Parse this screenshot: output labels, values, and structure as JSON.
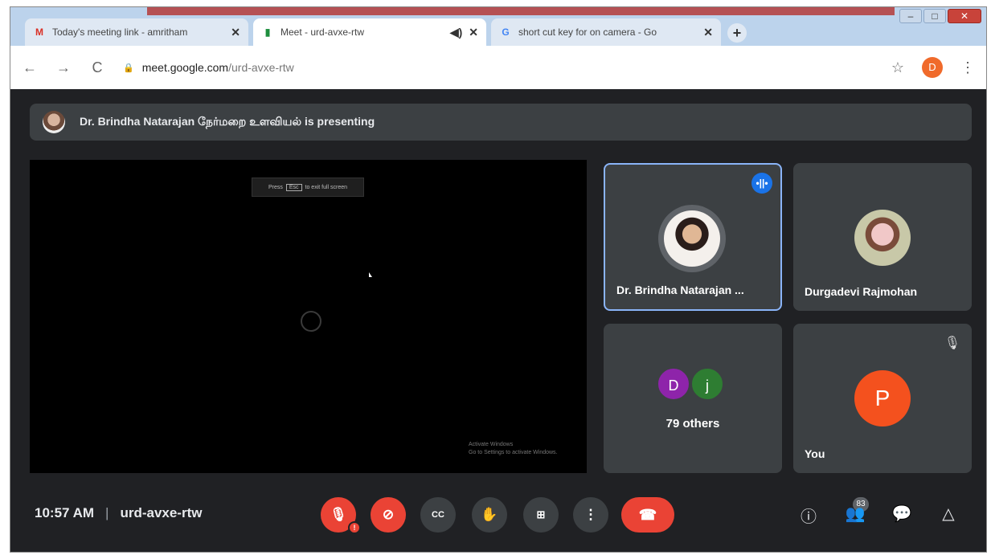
{
  "browser": {
    "tabs": [
      {
        "favicon": "M",
        "title": "Today's meeting link - amritham",
        "close": "✕"
      },
      {
        "favicon": "▮",
        "title": "Meet - urd-avxe-rtw",
        "audio": "◀)",
        "close": "✕"
      },
      {
        "favicon": "G",
        "title": "short cut key for on camera - Go",
        "close": "✕"
      }
    ],
    "new_tab": "+",
    "window_controls": {
      "minimize": "–",
      "maximize": "□",
      "close": "✕"
    },
    "back": "←",
    "forward": "→",
    "reload": "C",
    "lock": "🔒",
    "url_host": "meet.google.com",
    "url_path": "/urd-avxe-rtw",
    "bookmark": "☆",
    "profile_initial": "D",
    "menu": "⋮"
  },
  "banner": {
    "text": "Dr. Brindha Natarajan நேர்மறை உளவியல் is presenting"
  },
  "presentation": {
    "hint_prefix": "Press",
    "hint_key": "Esc",
    "hint_suffix": "to exit full screen",
    "footer_line1": "Activate Windows",
    "footer_line2": "Go to Settings to activate Windows."
  },
  "tiles": {
    "speaker": {
      "name": "Dr. Brindha Natarajan ...",
      "speaking_icon": "•||•"
    },
    "participant": {
      "name": "Durgadevi Rajmohan"
    },
    "others": {
      "d_initial": "D",
      "j_initial": "j",
      "label": "79 others"
    },
    "self": {
      "initial": "P",
      "name": "You",
      "muted_icon": "🎙"
    }
  },
  "bottom": {
    "time": "10:57 AM",
    "separator": "|",
    "meeting_code": "urd-avxe-rtw",
    "mic_icon": "🎙",
    "mic_badge": "!",
    "cam_icon": "⊘",
    "cc_label": "CC",
    "hand_icon": "✋",
    "present_icon": "⊞",
    "more_icon": "⋮",
    "leave_icon": "☎",
    "info_icon": "ⓘ",
    "people_icon": "👥",
    "people_count": "83",
    "chat_icon": "💬",
    "activities_icon": "△"
  },
  "colors": {
    "background": "#202124",
    "tile": "#3c4043",
    "red": "#ea4335",
    "active_border": "#8ab4f8",
    "speaking_badge": "#1a73e8"
  }
}
